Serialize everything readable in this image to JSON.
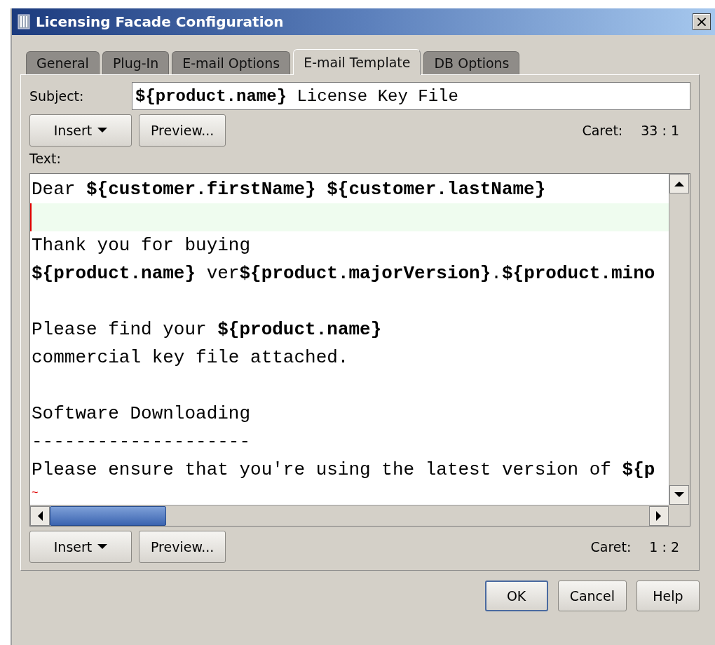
{
  "window": {
    "title": "Licensing Facade Configuration",
    "close": "×"
  },
  "tabs": [
    {
      "label": "General",
      "selected": false
    },
    {
      "label": "Plug-In",
      "selected": false
    },
    {
      "label": "E-mail Options",
      "selected": false
    },
    {
      "label": "E-mail Template",
      "selected": true
    },
    {
      "label": "DB Options",
      "selected": false
    }
  ],
  "subject": {
    "label": "Subject:",
    "value": "**${product.name}** License Key File"
  },
  "top_toolbar": {
    "insert": "Insert",
    "preview": "Preview...",
    "caret_label": "Caret:",
    "caret_value": "33 : 1"
  },
  "text_label": "Text:",
  "editor": {
    "lines": [
      {
        "kind": "text",
        "text": "Dear **${customer.firstName} ${customer.lastName}**"
      },
      {
        "kind": "current"
      },
      {
        "kind": "text",
        "text": "Thank you for buying"
      },
      {
        "kind": "text",
        "text": "**${product.name}** ver**${product.majorVersion}**.**${product.mino**"
      },
      {
        "kind": "blank"
      },
      {
        "kind": "text",
        "text": "Please find your **${product.name}**"
      },
      {
        "kind": "text",
        "text": "commercial key file attached."
      },
      {
        "kind": "blank"
      },
      {
        "kind": "text",
        "text": "Software Downloading"
      },
      {
        "kind": "text",
        "text": "--------------------"
      },
      {
        "kind": "text",
        "text": "Please ensure that you're using the latest version of **${p**"
      },
      {
        "kind": "eof",
        "text": "~"
      }
    ]
  },
  "bottom_toolbar": {
    "insert": "Insert",
    "preview": "Preview...",
    "caret_label": "Caret:",
    "caret_value": "1 : 2"
  },
  "buttons": [
    {
      "label": "OK",
      "default": true
    },
    {
      "label": "Cancel",
      "default": false
    },
    {
      "label": "Help",
      "default": false
    }
  ]
}
